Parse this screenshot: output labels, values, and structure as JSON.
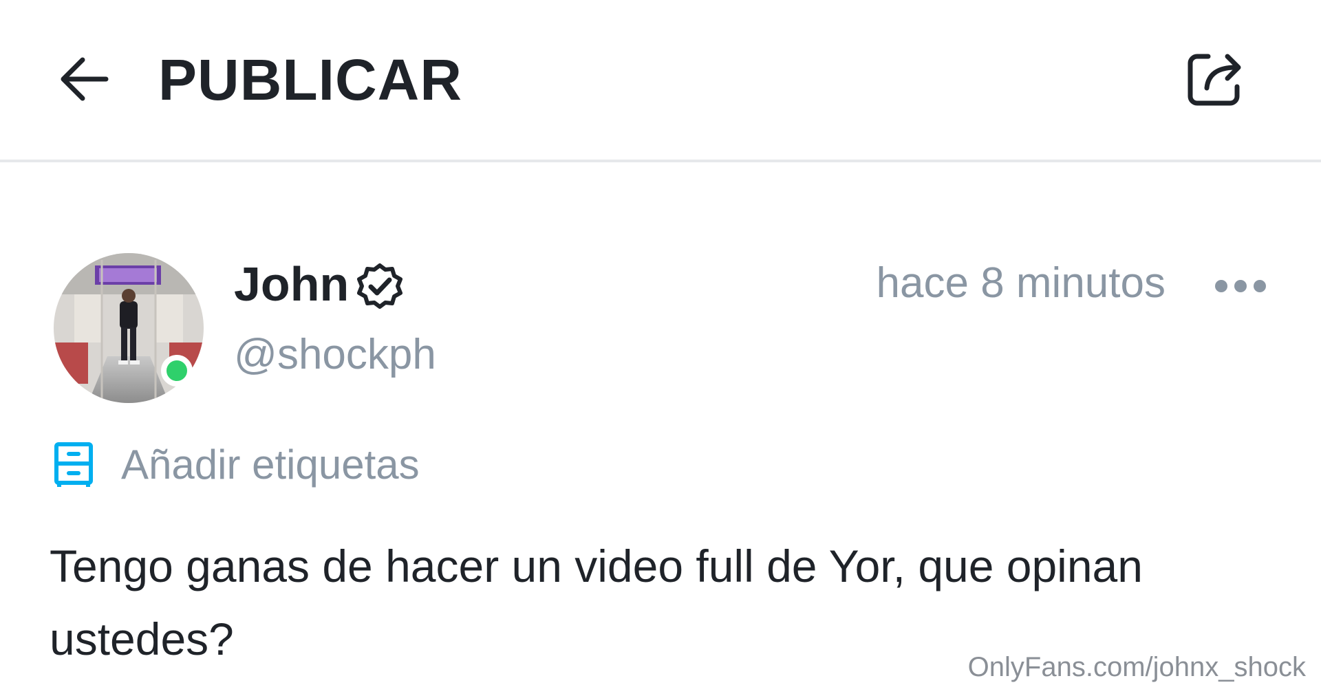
{
  "header": {
    "title": "PUBLICAR",
    "back_icon": "arrow-left-icon",
    "share_icon": "share-icon"
  },
  "post": {
    "author": {
      "name": "John",
      "handle": "@shockph",
      "verified": true,
      "online": true,
      "avatar_icon": "user-avatar-photo"
    },
    "timestamp": "hace 8 minutos",
    "more_icon": "more-dots-icon",
    "tags": {
      "label": "Añadir etiquetas",
      "icon": "tag-drawer-icon"
    },
    "text": "Tengo ganas de hacer un video full de Yor, que opinan ustedes?"
  },
  "watermark": "OnlyFans.com/johnx_shock",
  "colors": {
    "text_primary": "#1f2329",
    "text_secondary": "#8a96a3",
    "accent": "#00aff0",
    "online": "#2fd06b",
    "divider": "#e6e8eb"
  }
}
